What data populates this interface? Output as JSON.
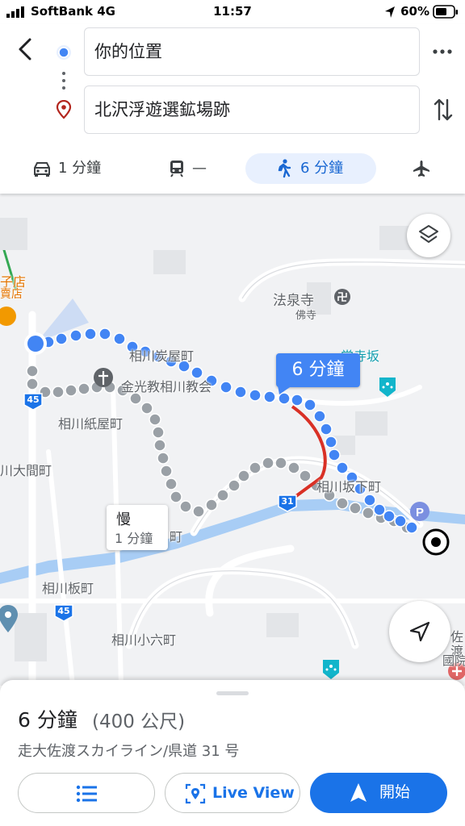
{
  "status_bar": {
    "carrier": "SoftBank 4G",
    "time": "11:57",
    "battery": "60%"
  },
  "directions": {
    "origin": "你的位置",
    "destination": "北沢浮遊選鉱場跡"
  },
  "modes": [
    {
      "icon": "car-icon",
      "label": "1 分鐘"
    },
    {
      "icon": "train-icon",
      "label": "—"
    },
    {
      "icon": "walk-icon",
      "label": "6 分鐘"
    },
    {
      "icon": "flight-icon",
      "label": ""
    }
  ],
  "map": {
    "labels": {
      "hoho": "法泉寺",
      "hoho_sub": "佛寺",
      "shinjo": "常寺坂",
      "sumiya": "相川炭屋町",
      "church": "金光教相川教会",
      "kamiya": "相川紙屋町",
      "oma": "川大間町",
      "sakashita": "相川坂下町",
      "itamachi": "相川板町",
      "kororoku": "相川小六町",
      "store1": "子店",
      "store2": "賣店",
      "store3": "佐",
      "store4": "渡",
      "store5": "國院",
      "road45a": "45",
      "road45b": "45",
      "road31": "31"
    },
    "route_badge": "6 分鐘",
    "alt_badge": {
      "title": "慢",
      "time": "1 分鐘"
    },
    "partial_label": "町"
  },
  "summary": {
    "duration": "6 分鐘",
    "distance": "(400 公尺)",
    "via": "走大佐渡スカイライン/県道 31 号"
  },
  "buttons": {
    "steps": "",
    "live_view": "Live View",
    "start": "開始"
  },
  "colors": {
    "route": "#4285f4",
    "alt": "#9aa0a6",
    "slow": "#d93025",
    "accent": "#1a73e8"
  }
}
